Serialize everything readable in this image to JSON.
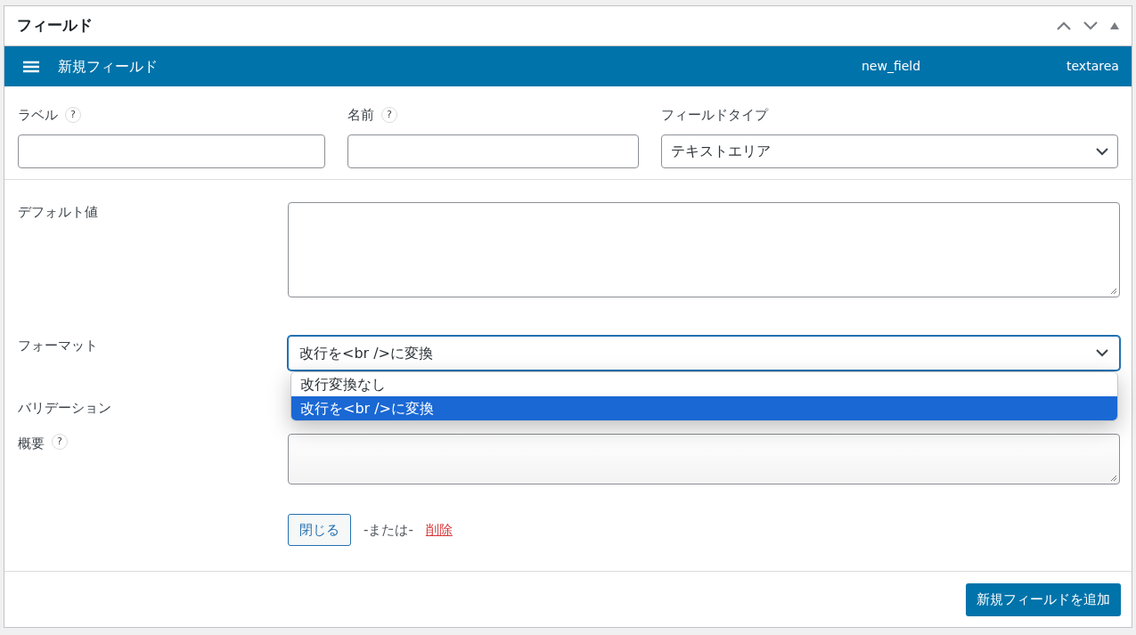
{
  "panel": {
    "title": "フィールド"
  },
  "field_header": {
    "label": "新規フィールド",
    "name": "new_field",
    "type": "textarea"
  },
  "top_fields": [
    {
      "label": "ラベル",
      "help": "?",
      "kind": "input"
    },
    {
      "label": "名前",
      "help": "?",
      "kind": "input"
    },
    {
      "label": "フィールドタイプ",
      "kind": "select",
      "value": "テキストエリア"
    }
  ],
  "rows": [
    {
      "label": "デフォルト値",
      "kind": "textarea"
    },
    {
      "label": "フォーマット",
      "kind": "select",
      "value": "改行を<br />に変換",
      "open": true,
      "options": [
        {
          "label": "改行変換なし",
          "selected": false
        },
        {
          "label": "改行を<br />に変換",
          "selected": true
        }
      ]
    },
    {
      "label": "バリデーション",
      "kind": "hidden"
    },
    {
      "label": "概要",
      "help": "?",
      "kind": "textarea_small"
    }
  ],
  "actions": {
    "close": "閉じる",
    "or": "-または-",
    "delete": "削除"
  },
  "footer": {
    "add_button": "新規フィールドを追加"
  }
}
